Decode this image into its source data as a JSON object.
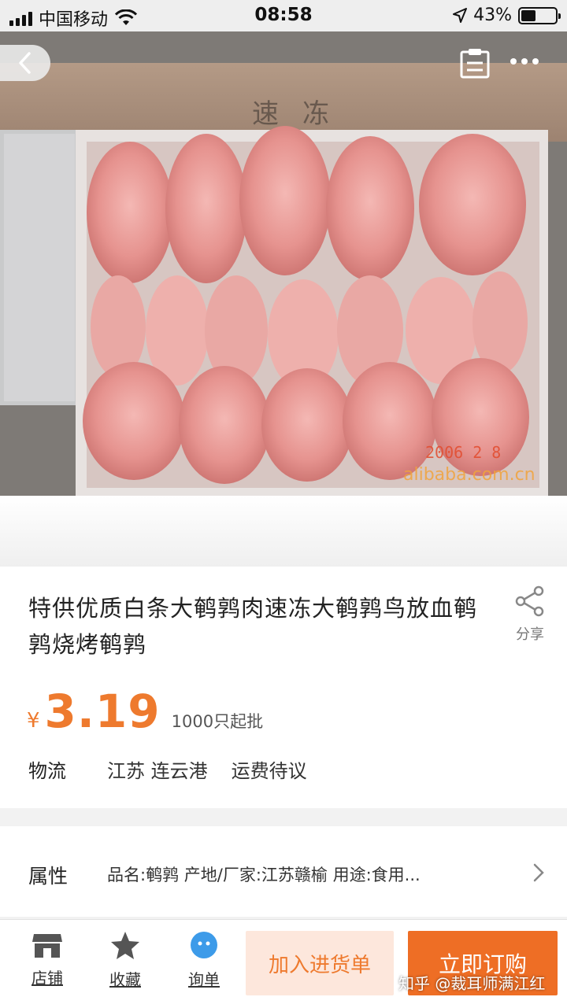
{
  "status_bar": {
    "carrier": "中国移动",
    "time": "08:58",
    "battery": "43%",
    "battery_level": 0.43
  },
  "nav": {
    "back_icon": "chevron-left-icon",
    "clipboard_icon": "clipboard-icon",
    "more_icon": "more-dots-icon"
  },
  "hero": {
    "box_text": "速冻",
    "watermark_text": "2006 2 8",
    "watermark_site": "alibaba.com.cn"
  },
  "product": {
    "title": "特供优质白条大鹌鹑肉速冻大鹌鹑鸟放血鹌鹑烧烤鹌鹑",
    "share_label": "分享",
    "currency": "¥",
    "price": "3.19",
    "min_order": "1000只起批",
    "logistics_label": "物流",
    "logistics_region": "江苏 连云港",
    "logistics_fee": "运费待议"
  },
  "attributes": {
    "label": "属性",
    "value": "品名:鹌鹑  产地/厂家:江苏赣榆  用途:食用..."
  },
  "bottom_bar": {
    "tabs": [
      {
        "label": "店铺",
        "icon": "store-icon"
      },
      {
        "label": "收藏",
        "icon": "star-icon"
      },
      {
        "label": "询单",
        "icon": "chat-icon"
      }
    ],
    "add_to_cart": "加入进货单",
    "buy_now": "立即订购",
    "colors": {
      "accent": "#ee7a2e",
      "buy_bg": "#ee6e25",
      "cart_bg": "#fde7dc",
      "icon": "#555555",
      "chat": "#3d9be9"
    }
  },
  "watermark": "知乎 @裁耳师满江红"
}
